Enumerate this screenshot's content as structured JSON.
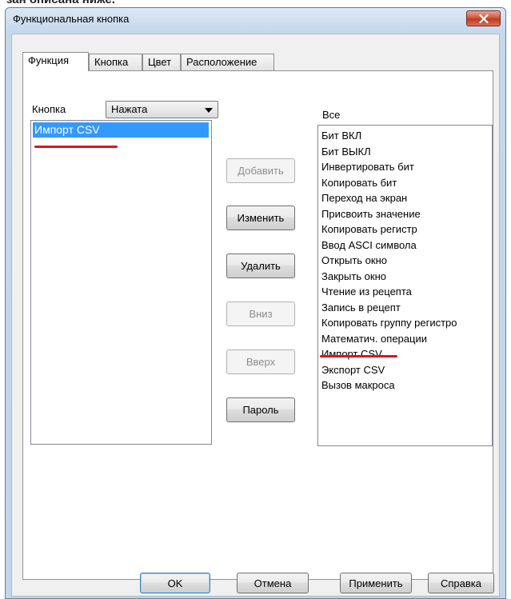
{
  "window": {
    "title": "Функциональная кнопка",
    "partial_heading": "зан описана ниже."
  },
  "tabs": [
    {
      "label": "Функция",
      "active": true
    },
    {
      "label": "Кнопка",
      "active": false
    },
    {
      "label": "Цвет",
      "active": false
    },
    {
      "label": "Расположение",
      "active": false
    }
  ],
  "left": {
    "label": "Кнопка",
    "combo_value": "Нажата",
    "items": [
      "Импорт CSV"
    ],
    "selected_index": 0
  },
  "middle_buttons": [
    {
      "label": "Добавить",
      "enabled": false
    },
    {
      "label": "Изменить",
      "enabled": true
    },
    {
      "label": "Удалить",
      "enabled": true
    },
    {
      "label": "Вниз",
      "enabled": false
    },
    {
      "label": "Вверх",
      "enabled": false
    },
    {
      "label": "Пароль",
      "enabled": true
    }
  ],
  "right": {
    "label": "Все",
    "items": [
      "Бит ВКЛ",
      "Бит ВЫКЛ",
      "Инвертировать бит",
      "Копировать бит",
      "Переход на экран",
      "Присвоить значение",
      "Копировать регистр",
      "Ввод ASCI символа",
      "Открыть окно",
      "Закрыть окно",
      "Чтение из рецепта",
      "Запись в рецепт",
      "Копировать группу регистро",
      "Математич. операции",
      "Импорт CSV",
      "Экспорт CSV",
      "Вызов макроса"
    ]
  },
  "footer": {
    "ok": "OK",
    "cancel": "Отмена",
    "apply": "Применить",
    "help": "Справка"
  },
  "colors": {
    "selection": "#3399ff",
    "annotation_underline": "#e0141a",
    "close_button": "#c75050"
  }
}
